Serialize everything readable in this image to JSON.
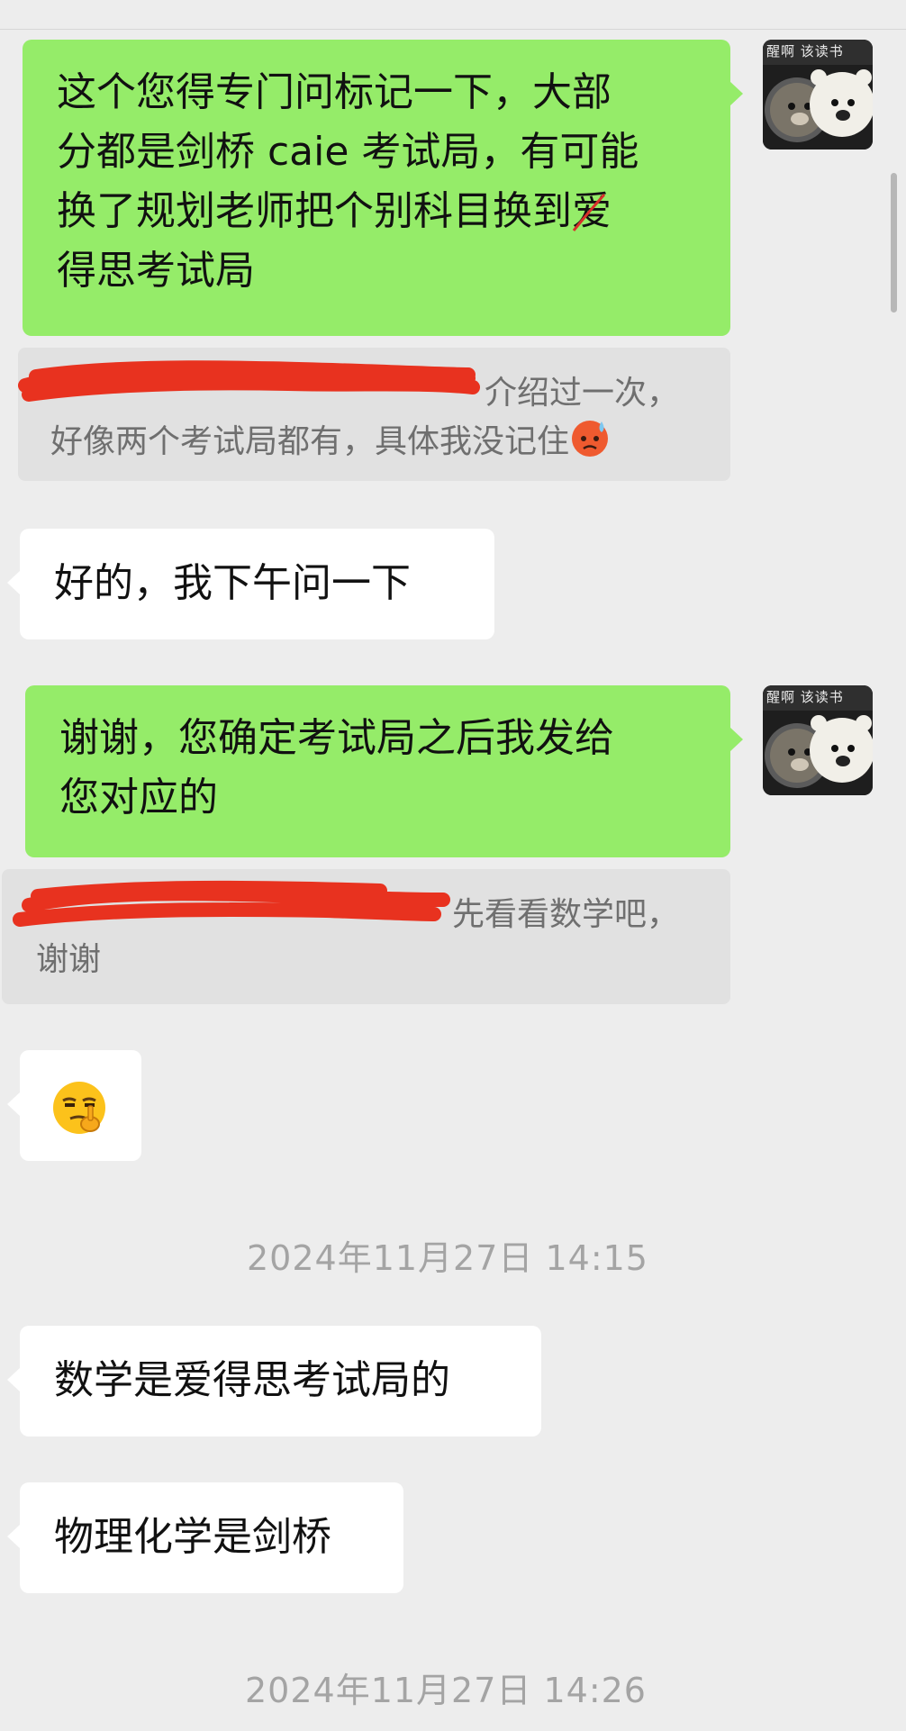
{
  "messages": {
    "m1": "这个您得专门问标记一下，大部分都是剑桥 caie 考试局，有可能换了规划老师把个别科目换到爱得思考试局",
    "m1_line1": "这个您得专门问标记一下，大部",
    "m1_line2": "分都是剑桥 caie 考试局，有可能",
    "m1_line3_pre": "换了规划老师把个别科目换到",
    "m1_line3_strike": "爱",
    "m1_line4": "得思考试局",
    "q1_line1": "介绍过一次，",
    "q1_line2": "好像两个考试局都有，具体我没记住",
    "m2": "好的，我下午问一下",
    "m3_line1": "谢谢，您确定考试局之后我发给",
    "m3_line2": "您对应的",
    "q2_line1": "先看看数学吧，",
    "q2_line2": "谢谢",
    "m5": "数学是爱得思考试局的",
    "m6": "物理化学是剑桥"
  },
  "timestamps": {
    "t1": "2024年11月27日 14:15",
    "t2": "2024年11月27日 14:26"
  },
  "avatar": {
    "caption": "醒啊 该读书"
  },
  "icons": {
    "q1_emoji": "anxious-sweat-face-icon",
    "m4_emoji": "smirk-shush-face-icon"
  },
  "colors": {
    "outgoing_bubble": "#95ec69",
    "incoming_bubble": "#ffffff",
    "quote_bg": "#e1e1e1",
    "background": "#ededed",
    "redaction": "#e8321f"
  }
}
